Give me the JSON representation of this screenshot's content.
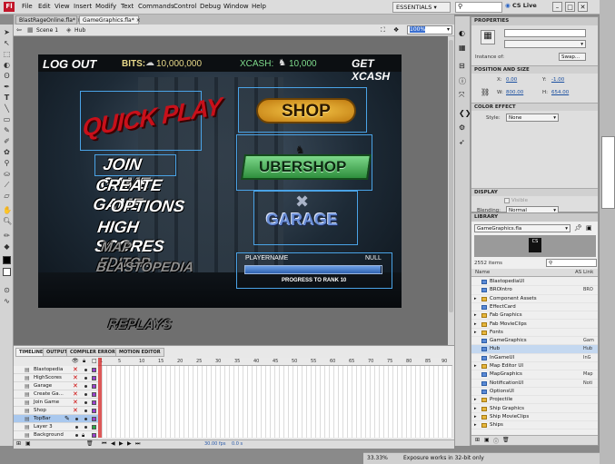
{
  "menubar": {
    "items": [
      "File",
      "Edit",
      "View",
      "Insert",
      "Modify",
      "Text",
      "Commands",
      "Control",
      "Debug",
      "Window",
      "Help"
    ],
    "workspace": "ESSENTIALS",
    "cs_live": "CS Live"
  },
  "tabs": [
    {
      "label": "BlastRageOnline.fla*"
    },
    {
      "label": "GameGraphics.fla*"
    }
  ],
  "editbar": {
    "scene": "Scene 1",
    "symbol": "Hub",
    "zoom": "100%"
  },
  "stage": {
    "logout": "LOG OUT",
    "bits_label": "BITS:",
    "bits_value": "10,000,000",
    "xcash_label": "XCASH:",
    "xcash_value": "10,000",
    "get_xcash": "GET XCASH",
    "quick_play": "QUICK PLAY",
    "shop": "SHOP",
    "ubershop": "UBERSHOP",
    "garage": "GARAGE",
    "menu": [
      "JOIN GAME",
      "CREATE GAME",
      "OPTIONS",
      "HIGH SCORES"
    ],
    "menu_dim": [
      "MAP EDITOR",
      "BLASTOPEDIA"
    ],
    "player_name": "PLAYERNAME",
    "rank_value": "NULL",
    "progress_label": "PROGRESS TO RANK 10",
    "replays": "REPLAYS"
  },
  "timeline": {
    "tabs": [
      "TIMELINE",
      "OUTPUT",
      "COMPILER ERRORS",
      "MOTION EDITOR"
    ],
    "frame_numbers": [
      "1",
      "5",
      "10",
      "15",
      "20",
      "25",
      "30",
      "35",
      "40",
      "45",
      "50",
      "55",
      "60",
      "65",
      "70",
      "75",
      "80",
      "85",
      "90",
      "95"
    ],
    "layers": [
      "Blastopedia",
      "HighScores",
      "Garage",
      "Create Ga...",
      "Join Game",
      "Shop",
      "TopBar",
      "Layer 3",
      "Background"
    ],
    "selected_layer": "TopBar",
    "fps": "30.00 fps",
    "time": "0.0 s"
  },
  "properties": {
    "title": "PROPERTIES",
    "instance_of": "Instance of:",
    "swap": "Swap...",
    "position_size": "POSITION AND SIZE",
    "x_label": "X:",
    "x_value": "0.00",
    "y_label": "Y:",
    "y_value": "-1.00",
    "w_label": "W:",
    "w_value": "800.00",
    "h_label": "H:",
    "h_value": "654.00",
    "color_effect": "COLOR EFFECT",
    "style_label": "Style:",
    "style_value": "None",
    "display": "DISPLAY",
    "visible": "Visible",
    "blending_label": "Blending:",
    "blending_value": "Normal"
  },
  "library": {
    "title": "LIBRARY",
    "file": "GameGraphics.fla",
    "count": "2552 items",
    "col_name": "Name",
    "col_link": "AS Link",
    "items": [
      {
        "name": "BlastopediaUI",
        "type": "sym",
        "link": ""
      },
      {
        "name": "BROIntro",
        "type": "sym",
        "link": "BRO"
      },
      {
        "name": "Component Assets",
        "type": "folder",
        "link": ""
      },
      {
        "name": "EffectCard",
        "type": "sym",
        "link": ""
      },
      {
        "name": "Fab Graphics",
        "type": "folder",
        "link": ""
      },
      {
        "name": "Fab MovieClips",
        "type": "folder",
        "link": ""
      },
      {
        "name": "Fonts",
        "type": "folder",
        "link": ""
      },
      {
        "name": "GameGraphics",
        "type": "sym",
        "link": "Gam"
      },
      {
        "name": "Hub",
        "type": "sym",
        "link": "Hub"
      },
      {
        "name": "InGameUI",
        "type": "sym",
        "link": "InG"
      },
      {
        "name": "Map Editor UI",
        "type": "folder",
        "link": ""
      },
      {
        "name": "MapGraphics",
        "type": "sym",
        "link": "Map"
      },
      {
        "name": "NotificationUI",
        "type": "sym",
        "link": "Noti"
      },
      {
        "name": "OptionsUI",
        "type": "sym",
        "link": ""
      },
      {
        "name": "Projectile",
        "type": "folder",
        "link": ""
      },
      {
        "name": "Ship Graphics",
        "type": "folder",
        "link": ""
      },
      {
        "name": "Ship MovieClips",
        "type": "folder",
        "link": ""
      },
      {
        "name": "Ships",
        "type": "folder",
        "link": ""
      }
    ],
    "selected": "Hub"
  },
  "status": {
    "zoom": "33.33%",
    "message": "Exposure works in 32-bit only"
  },
  "colors": {
    "accent": "#4aa3e6",
    "quickplay": "#c8101a",
    "shop_gold": "#e7a520",
    "uber_green": "#3aa54a",
    "garage_blue": "#6b8fd6",
    "xcash_green": "#7fdc8c",
    "progress": "#3f78c8"
  }
}
